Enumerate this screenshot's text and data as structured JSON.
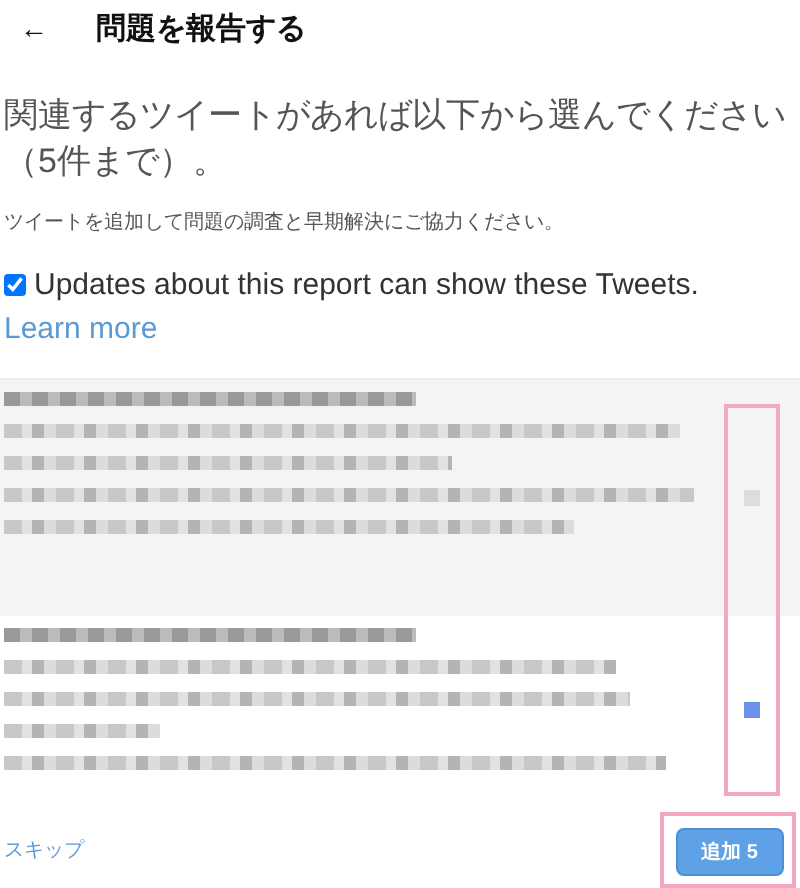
{
  "header": {
    "back": "←",
    "title": "問題を報告する"
  },
  "heading": "関連するツイートがあれば以下から選んでください（5件まで）。",
  "subtext": "ツイートを追加して問題の調査と早期解決にご協力ください。",
  "consent": {
    "label": "Updates about this report can show these Tweets.",
    "checked": true
  },
  "learn_more": "Learn more",
  "tweets": [
    {
      "selected": false
    },
    {
      "selected": true
    }
  ],
  "footer": {
    "skip": "スキップ",
    "add": "追加 5"
  }
}
